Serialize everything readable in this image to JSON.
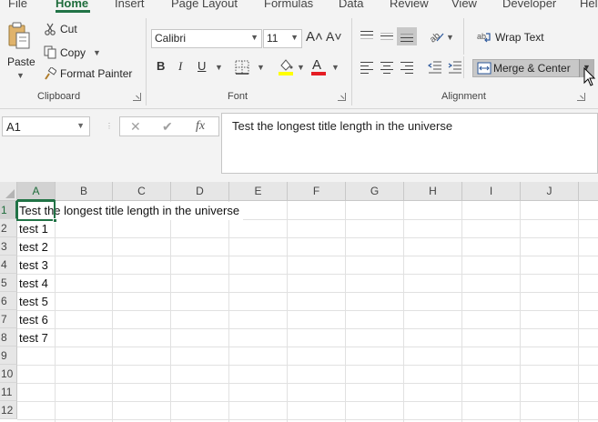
{
  "ribbon_tabs": [
    "File",
    "Home",
    "Insert",
    "Page Layout",
    "Formulas",
    "Data",
    "Review",
    "View",
    "Developer",
    "Hel"
  ],
  "clipboard": {
    "paste": "Paste",
    "cut": "Cut",
    "copy": "Copy",
    "format_painter": "Format Painter",
    "group_label": "Clipboard"
  },
  "font": {
    "name": "Calibri",
    "size": "11",
    "bold": "B",
    "italic": "I",
    "underline": "U",
    "grow": "A˄",
    "shrink": "A˅",
    "font_color_glyph": "A",
    "group_label": "Font"
  },
  "alignment": {
    "wrap_text": "Wrap Text",
    "merge_center": "Merge & Center",
    "group_label": "Alignment"
  },
  "formula_bar": {
    "name_box": "A1",
    "cancel": "✕",
    "enter": "✔",
    "fx": "fx",
    "content": "Test the longest title length in the universe"
  },
  "grid": {
    "columns": [
      "A",
      "B",
      "C",
      "D",
      "E",
      "F",
      "G",
      "H",
      "I",
      "J"
    ],
    "rows": [
      "1",
      "2",
      "3",
      "4",
      "5",
      "6",
      "7",
      "8",
      "9",
      "10",
      "11",
      "12"
    ],
    "cells": [
      "Test the longest title length in the universe",
      "test 1",
      "test 2",
      "test 3",
      "test 4",
      "test 5",
      "test 6",
      "test 7"
    ],
    "selected_cell": "A1"
  },
  "colors": {
    "accent": "#217346",
    "ribbon_bg": "#f3f3f3",
    "highlight_yellow": "#ffff00",
    "font_red": "#e51c23"
  }
}
